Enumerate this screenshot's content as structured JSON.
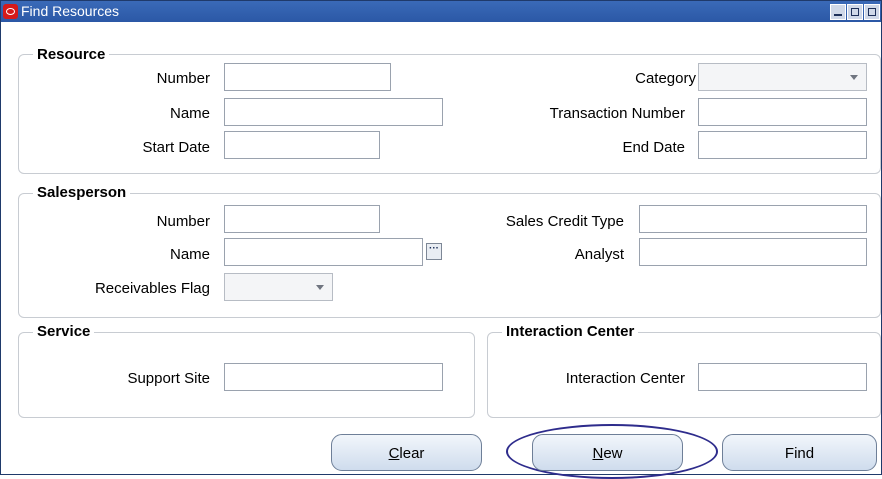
{
  "window": {
    "title": "Find Resources",
    "icons": {
      "app": "oracle-logo-icon",
      "minimize": "minimize-icon",
      "maximize": "maximize-icon",
      "close": "close-icon"
    }
  },
  "resource": {
    "title": "Resource",
    "number_label": "Number",
    "number_value": "",
    "name_label": "Name",
    "name_value": "",
    "start_date_label": "Start Date",
    "start_date_value": "",
    "category_label": "Category",
    "category_value": "",
    "transaction_number_label": "Transaction Number",
    "transaction_number_value": "",
    "end_date_label": "End Date",
    "end_date_value": ""
  },
  "salesperson": {
    "title": "Salesperson",
    "number_label": "Number",
    "number_value": "",
    "name_label": "Name",
    "name_value": "",
    "lov_icon": "ellipsis-icon",
    "receivables_flag_label": "Receivables Flag",
    "receivables_flag_value": "",
    "sales_credit_type_label": "Sales Credit Type",
    "sales_credit_type_value": "",
    "analyst_label": "Analyst",
    "analyst_value": ""
  },
  "service": {
    "title": "Service",
    "support_site_label": "Support Site",
    "support_site_value": ""
  },
  "interaction_center": {
    "title": "Interaction Center",
    "field_label": "Interaction Center",
    "field_value": ""
  },
  "buttons": {
    "clear_mnemonic": "C",
    "clear_rest": "lear",
    "new_mnemonic": "N",
    "new_rest": "ew",
    "find": "Find"
  },
  "colors": {
    "titlebar": "#2b58a6",
    "highlight": "#2e2c8c",
    "button_border": "#6e7f98"
  }
}
